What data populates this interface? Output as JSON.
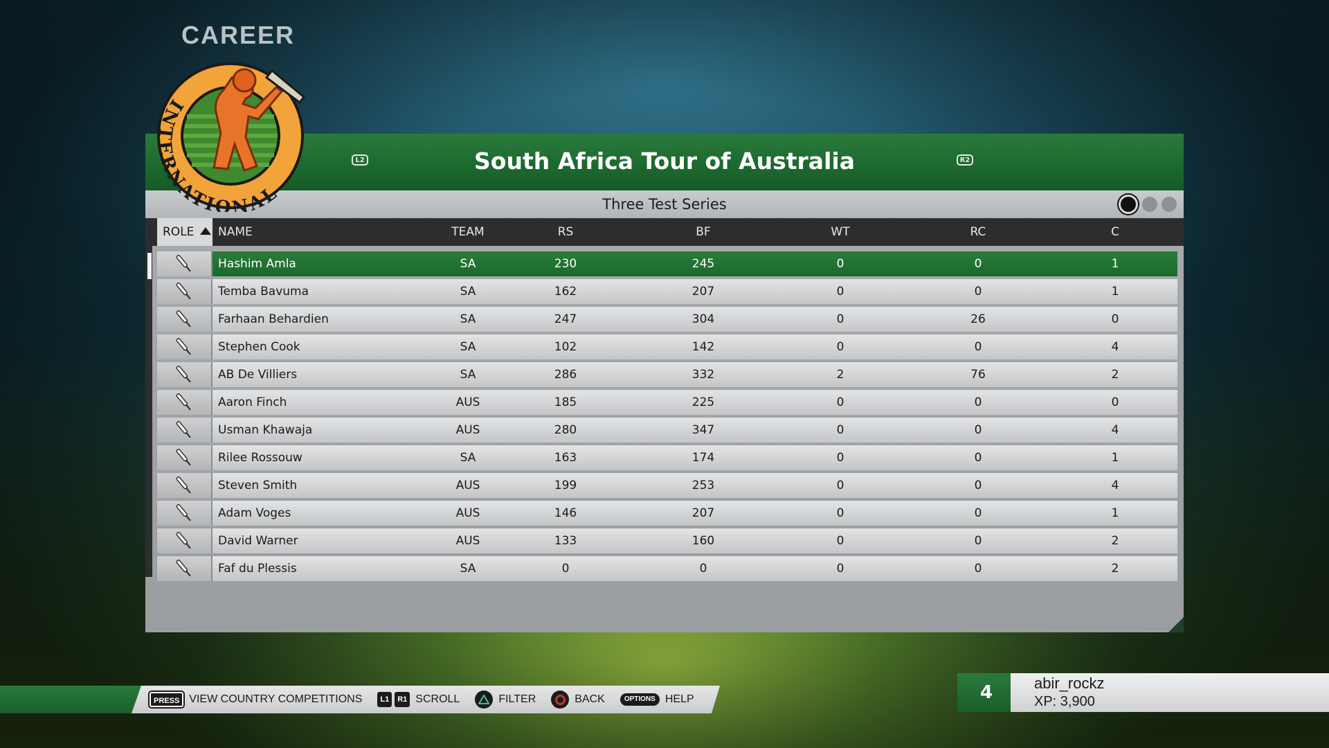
{
  "header": {
    "career_label": "CAREER",
    "logo_text": "INTERNATIONAL"
  },
  "panel": {
    "title": "South Africa Tour of Australia",
    "left_shoulder": "L2",
    "right_shoulder": "R2",
    "subtitle": "Three Test Series",
    "page_count": 3,
    "active_page": 1
  },
  "table": {
    "columns": {
      "role": "ROLE",
      "name": "NAME",
      "team": "TEAM",
      "rs": "RS",
      "bf": "BF",
      "wt": "WT",
      "rc": "RC",
      "c": "C"
    },
    "role_icon": "cricket-bat-icon",
    "selected_row": 0,
    "rows": [
      {
        "name": "Hashim Amla",
        "team": "SA",
        "rs": "230",
        "bf": "245",
        "wt": "0",
        "rc": "0",
        "c": "1"
      },
      {
        "name": "Temba Bavuma",
        "team": "SA",
        "rs": "162",
        "bf": "207",
        "wt": "0",
        "rc": "0",
        "c": "1"
      },
      {
        "name": "Farhaan Behardien",
        "team": "SA",
        "rs": "247",
        "bf": "304",
        "wt": "0",
        "rc": "26",
        "c": "0"
      },
      {
        "name": "Stephen Cook",
        "team": "SA",
        "rs": "102",
        "bf": "142",
        "wt": "0",
        "rc": "0",
        "c": "4"
      },
      {
        "name": "AB De Villiers",
        "team": "SA",
        "rs": "286",
        "bf": "332",
        "wt": "2",
        "rc": "76",
        "c": "2"
      },
      {
        "name": "Aaron Finch",
        "team": "AUS",
        "rs": "185",
        "bf": "225",
        "wt": "0",
        "rc": "0",
        "c": "0"
      },
      {
        "name": "Usman Khawaja",
        "team": "AUS",
        "rs": "280",
        "bf": "347",
        "wt": "0",
        "rc": "0",
        "c": "4"
      },
      {
        "name": "Rilee Rossouw",
        "team": "SA",
        "rs": "163",
        "bf": "174",
        "wt": "0",
        "rc": "0",
        "c": "1"
      },
      {
        "name": "Steven Smith",
        "team": "AUS",
        "rs": "199",
        "bf": "253",
        "wt": "0",
        "rc": "0",
        "c": "4"
      },
      {
        "name": "Adam Voges",
        "team": "AUS",
        "rs": "146",
        "bf": "207",
        "wt": "0",
        "rc": "0",
        "c": "1"
      },
      {
        "name": "David Warner",
        "team": "AUS",
        "rs": "133",
        "bf": "160",
        "wt": "0",
        "rc": "0",
        "c": "2"
      },
      {
        "name": "Faf du Plessis",
        "team": "SA",
        "rs": "0",
        "bf": "0",
        "wt": "0",
        "rc": "0",
        "c": "2"
      }
    ]
  },
  "controls": {
    "press_btn": "PRESS",
    "press_label": "VIEW COUNTRY COMPETITIONS",
    "l1_btn": "L1",
    "r1_btn": "R1",
    "scroll_label": "SCROLL",
    "filter_label": "FILTER",
    "back_label": "BACK",
    "options_btn": "OPTIONS",
    "help_label": "HELP"
  },
  "profile": {
    "level": "4",
    "username": "abir_rockz",
    "xp": "XP: 3,900"
  },
  "colors": {
    "accent_green": "#1d6a30",
    "row_light": "#d6d7d8",
    "header_dark": "#2b2d2f"
  }
}
